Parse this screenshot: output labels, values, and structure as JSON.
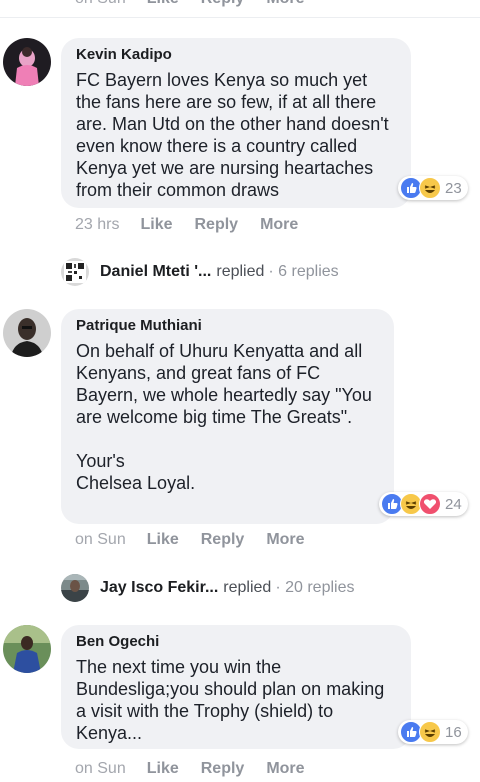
{
  "top_partial_actions": {
    "time": "on Sun",
    "like": "Like",
    "reply": "Reply",
    "more": "More"
  },
  "comments": [
    {
      "author": "Kevin Kadipo",
      "text": "FC Bayern loves Kenya so much yet the fans here are so few, if at all there are. Man Utd on the other hand doesn't even know there is a country called Kenya yet we are nursing heartaches from their common draws",
      "reaction_count": "23",
      "reactions": [
        "like-icon",
        "haha-icon"
      ],
      "time": "23 hrs",
      "like": "Like",
      "reply": "Reply",
      "more": "More"
    },
    {
      "author": "Patrique Muthiani",
      "text": "On behalf of Uhuru Kenyatta and all Kenyans, and great fans of FC Bayern, we whole heartedly say \"You are welcome big time The Greats\".\n\nYour's\nChelsea Loyal.",
      "reaction_count": "24",
      "reactions": [
        "like-icon",
        "haha-icon",
        "love-icon"
      ],
      "time": "on Sun",
      "like": "Like",
      "reply": "Reply",
      "more": "More"
    },
    {
      "author": "Ben Ogechi",
      "text": "The next time you win the Bundesliga;you should plan on making a visit with the Trophy (shield) to Kenya...",
      "reaction_count": "16",
      "reactions": [
        "like-icon",
        "haha-icon"
      ],
      "time": "on Sun",
      "like": "Like",
      "reply": "Reply",
      "more": "More"
    }
  ],
  "reply_threads": [
    {
      "name": "Daniel Mteti '...",
      "verb": "replied",
      "count": "· 6 replies"
    },
    {
      "name": "Jay Isco Fekir...",
      "verb": "replied",
      "count": "· 20 replies"
    }
  ],
  "colors": {
    "like": "#4a7bf0",
    "haha": "#f7c84a",
    "love": "#f0506e",
    "bubble": "#f0f1f4",
    "meta": "#90949c"
  }
}
